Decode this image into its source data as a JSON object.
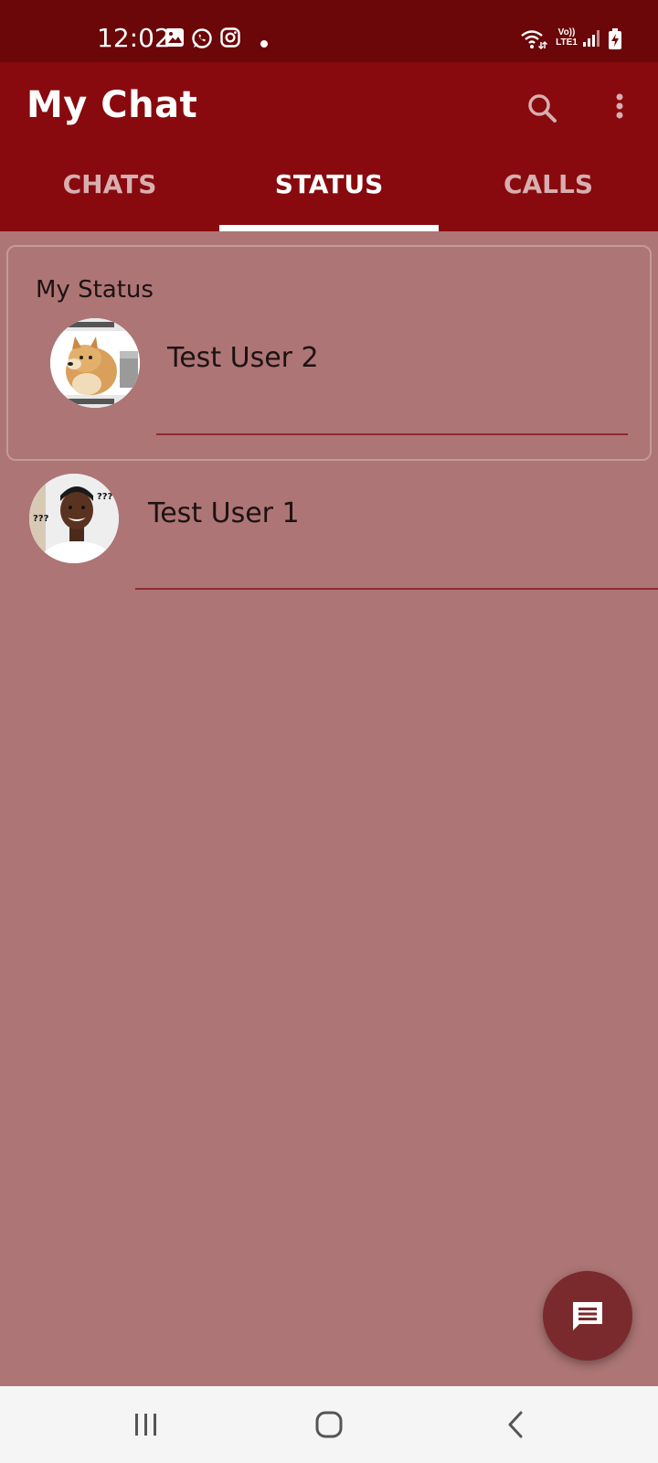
{
  "status_bar": {
    "time": "12:02",
    "icons": [
      "gallery-icon",
      "whatsapp-icon",
      "instagram-icon",
      "notification-dot-icon",
      "wifi-icon",
      "volte-lte-icon",
      "signal-icon",
      "battery-charging-icon"
    ],
    "network_label_top": "Vo))",
    "network_label_bottom": "LTE1"
  },
  "app_bar": {
    "title": "My Chat",
    "actions": [
      "search-icon",
      "more-vert-icon"
    ]
  },
  "tabs": [
    {
      "label": "CHATS",
      "active": false
    },
    {
      "label": "STATUS",
      "active": true
    },
    {
      "label": "CALLS",
      "active": false
    }
  ],
  "my_status": {
    "title": "My Status",
    "user": {
      "name": "Test User 2",
      "avatar": "doge-meme-avatar"
    }
  },
  "status_list": [
    {
      "name": "Test User 1",
      "avatar": "confused-man-avatar"
    }
  ],
  "fab": {
    "icon": "chat-message-icon"
  },
  "nav_bar": {
    "buttons": [
      "recents-icon",
      "home-icon",
      "back-icon"
    ]
  },
  "colors": {
    "status_bar": "#6b0609",
    "app_bar": "#880a0e",
    "background": "#ad7575",
    "fab": "#7a2a2d",
    "divider": "#8e2a2e"
  }
}
